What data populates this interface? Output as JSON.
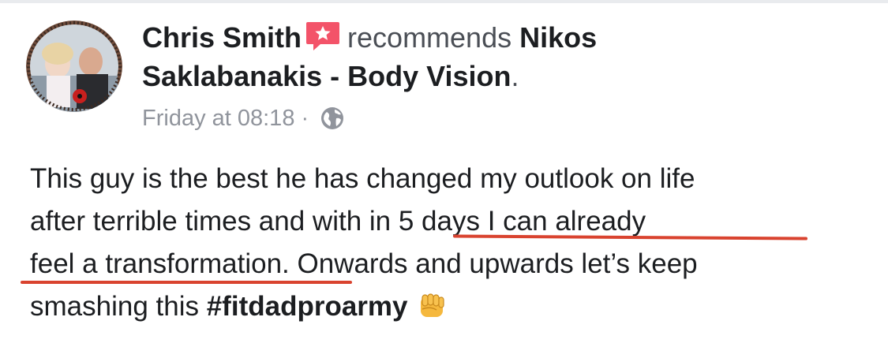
{
  "post": {
    "author_name": "Chris Smith",
    "verb": "recommends",
    "page_name_line1": "Nikos",
    "page_name_line2": "Saklabanakis - Body Vision",
    "period": ".",
    "timestamp": "Friday at 08:18",
    "separator": "·",
    "privacy_icon": "globe-icon",
    "recommend_icon": "star-speech-bubble-icon",
    "body": {
      "line1": "This guy is the best he has changed my outlook on life",
      "line2_a": "after terrible times and with ",
      "line2_b": "in 5 days I can already",
      "line3_a": "feel a transformation.",
      "line3_b": " Onwards and upwards let’s keep",
      "line4_a": "smashing this ",
      "hashtag": "#fitdadproarmy",
      "emoji": "fist-emoji-icon"
    },
    "colors": {
      "highlight_underline": "#d9432f",
      "recommend_badge": "#f35369",
      "meta_text": "#90949c"
    }
  }
}
